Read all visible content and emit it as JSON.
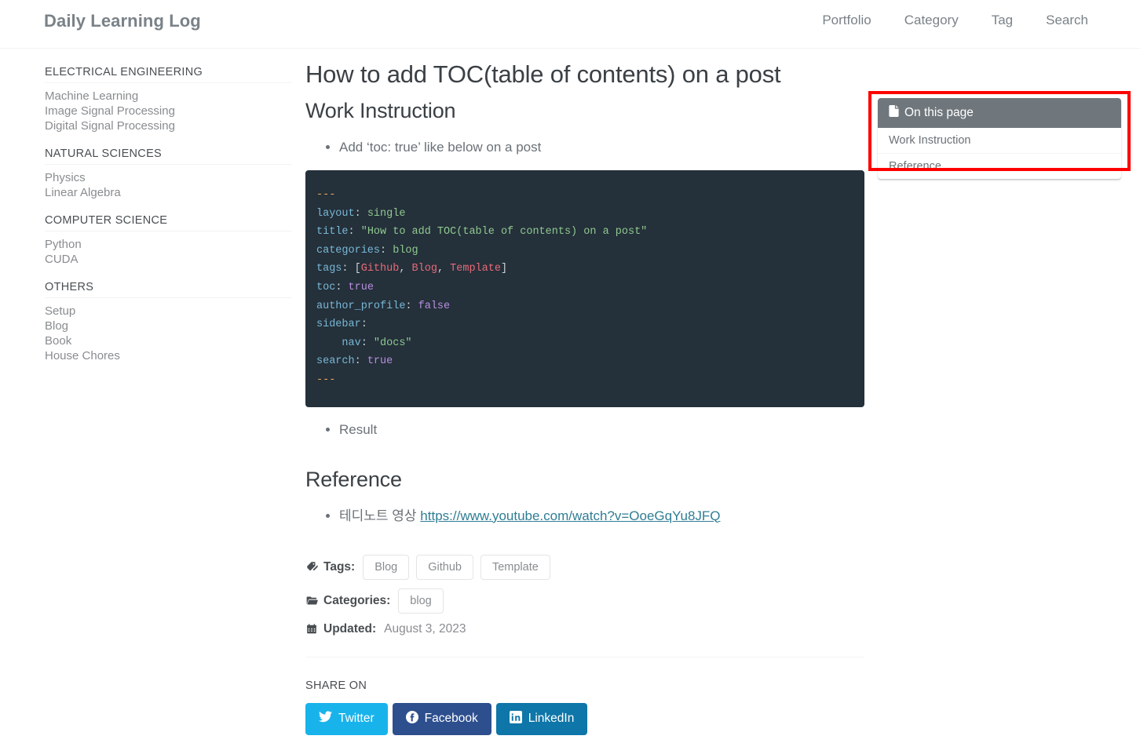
{
  "masthead": {
    "site_title": "Daily Learning Log",
    "nav": [
      {
        "label": "Portfolio"
      },
      {
        "label": "Category"
      },
      {
        "label": "Tag"
      },
      {
        "label": "Search"
      }
    ]
  },
  "sidebar": {
    "groups": [
      {
        "title": "ELECTRICAL ENGINEERING",
        "links": [
          {
            "label": "Machine Learning"
          },
          {
            "label": "Image Signal Processing"
          },
          {
            "label": "Digital Signal Processing"
          }
        ]
      },
      {
        "title": "NATURAL SCIENCES",
        "links": [
          {
            "label": "Physics"
          },
          {
            "label": "Linear Algebra"
          }
        ]
      },
      {
        "title": "COMPUTER SCIENCE",
        "links": [
          {
            "label": "Python"
          },
          {
            "label": "CUDA"
          }
        ]
      },
      {
        "title": "OTHERS",
        "links": [
          {
            "label": "Setup"
          },
          {
            "label": "Blog"
          },
          {
            "label": "Book"
          },
          {
            "label": "House Chores"
          }
        ]
      }
    ]
  },
  "post": {
    "title": "How to add TOC(table of contents) on a post",
    "section_work": "Work Instruction",
    "bullet_add": "Add ‘toc: true’ like below on a post",
    "bullet_result": "Result",
    "section_reference": "Reference",
    "reference_prefix": "테디노트 영상 ",
    "reference_link": "https://www.youtube.com/watch?v=OoeGqYu8JFQ",
    "code": {
      "line_open": "---",
      "line_close": "---",
      "layout_key": "layout",
      "layout_val": "single",
      "title_key": "title",
      "title_val": "\"How to add TOC(table of contents) on a post\"",
      "categories_key": "categories",
      "categories_val": "blog",
      "tags_key": "tags",
      "tags_open": "[",
      "tag1": "Github",
      "tag2": "Blog",
      "tag3": "Template",
      "tags_close": "]",
      "comma": ", ",
      "toc_key": "toc",
      "toc_val": "true",
      "author_profile_key": "author_profile",
      "author_profile_val": "false",
      "sidebar_key": "sidebar",
      "nav_key": "nav",
      "nav_val": "\"docs\"",
      "search_key": "search",
      "search_val": "true",
      "colon": ": "
    }
  },
  "meta": {
    "tags_label": "Tags:",
    "tags": [
      {
        "label": "Blog"
      },
      {
        "label": "Github"
      },
      {
        "label": "Template"
      }
    ],
    "categories_label": "Categories:",
    "categories": [
      {
        "label": "blog"
      }
    ],
    "updated_label": "Updated:",
    "updated_value": "August 3, 2023",
    "icons": {
      "tags": "tags-icon",
      "categories": "folder-open-icon",
      "updated": "calendar-icon"
    }
  },
  "share": {
    "title": "SHARE ON",
    "buttons": [
      {
        "label": "Twitter",
        "icon": "twitter-icon",
        "color": "#19b3ec"
      },
      {
        "label": "Facebook",
        "icon": "facebook-icon",
        "color": "#2d4f8e"
      },
      {
        "label": "LinkedIn",
        "icon": "linkedin-icon",
        "color": "#0e76a8"
      }
    ]
  },
  "toc": {
    "header": "On this page",
    "header_icon": "file-document-icon",
    "items": [
      {
        "label": "Work Instruction"
      },
      {
        "label": "Reference"
      }
    ],
    "highlight_color": "#ff0000"
  }
}
